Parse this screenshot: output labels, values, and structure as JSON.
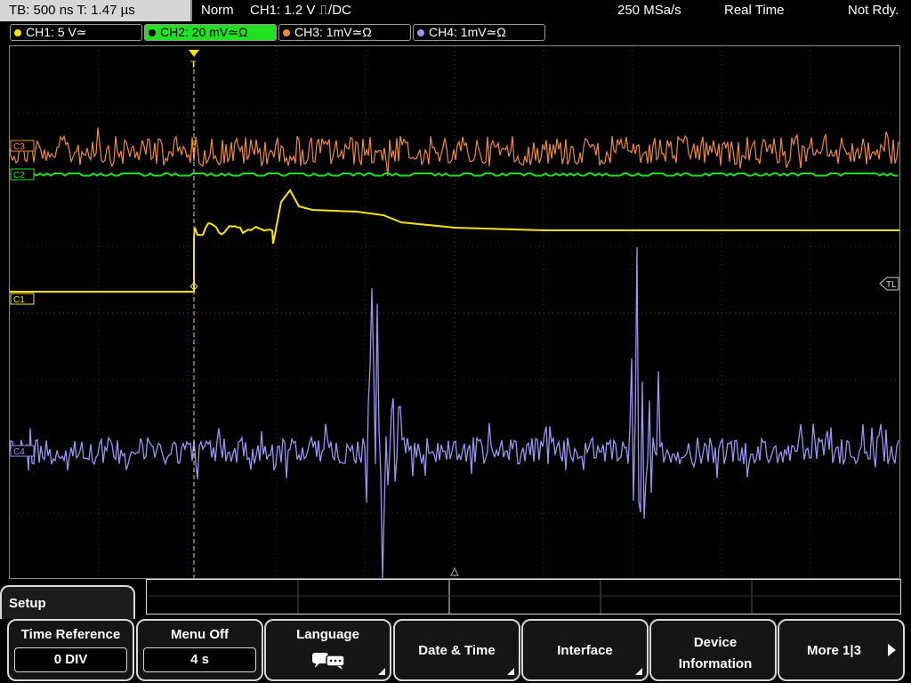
{
  "status": {
    "timebase": "TB: 500 ns  T: 1.47 µs",
    "mode": "Norm",
    "trigger": "CH1: 1.2 V ⎍/DC",
    "sample_rate": "250 MSa/s",
    "acq_mode": "Real Time",
    "state": "Not Rdy."
  },
  "channels": [
    {
      "label": "CH1: 5 V≃",
      "color": "#f5e21c",
      "active": false
    },
    {
      "label": "CH2: 20 mV≃Ω",
      "color": "#21e021",
      "active": true
    },
    {
      "label": "CH3: 1mV≃Ω",
      "color": "#f08a3a",
      "active": false
    },
    {
      "label": "CH4: 1mV≃Ω",
      "color": "#9b94f2",
      "active": false
    }
  ],
  "markers": {
    "ch3": "C3",
    "ch2": "C2",
    "ch1": "C1",
    "ch4": "C4",
    "trigger_level": "TL",
    "trigger_pos": "T"
  },
  "setup_tab": "Setup",
  "softkeys": [
    {
      "label": "Time Reference",
      "value": "0 DIV"
    },
    {
      "label": "Menu Off",
      "value": "4 s"
    },
    {
      "label": "Language",
      "icon": "speech-bubble-icon"
    },
    {
      "label": "Date & Time"
    },
    {
      "label": "Interface"
    },
    {
      "label": "Device Information"
    },
    {
      "label": "More 1|3"
    }
  ]
}
